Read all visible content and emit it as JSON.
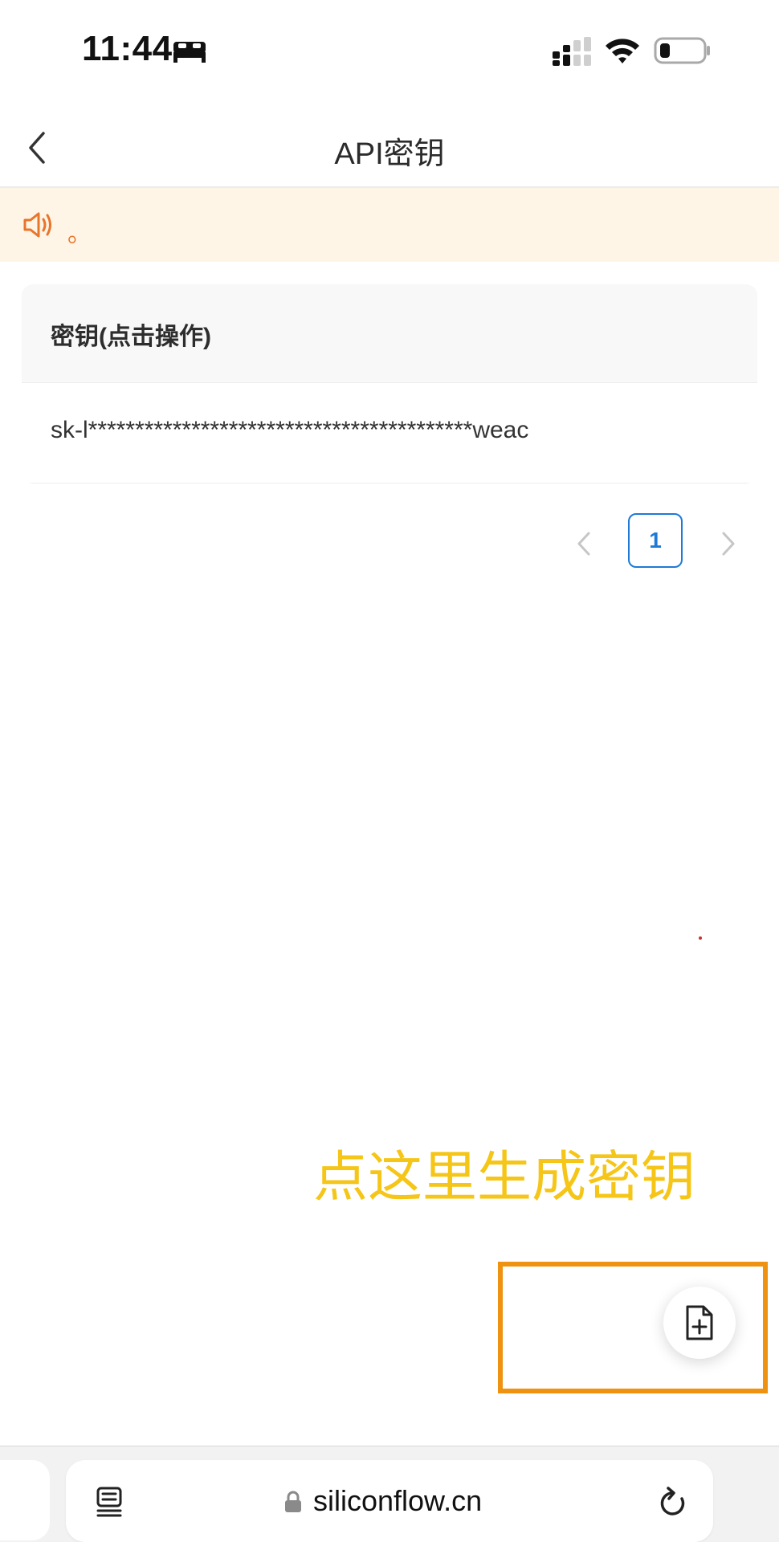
{
  "status_bar": {
    "time": "11:44"
  },
  "nav": {
    "title": "API密钥"
  },
  "notice": {
    "text": "。"
  },
  "table": {
    "header": "密钥(点击操作)",
    "rows": [
      {
        "key": "sk-l*****************************************weac"
      }
    ]
  },
  "pagination": {
    "current_page": "1"
  },
  "annotation": {
    "text": "点这里生成密钥"
  },
  "browser": {
    "url": "siliconflow.cn"
  },
  "icons": {
    "status": [
      "bed-icon",
      "cellular-signal-icon",
      "wifi-icon",
      "battery-icon"
    ],
    "nav": [
      "back-chevron-icon"
    ],
    "notice": [
      "speaker-icon"
    ],
    "fab": [
      "new-document-plus-icon"
    ],
    "browser": [
      "reader-icon",
      "lock-icon",
      "reload-icon"
    ]
  },
  "colors": {
    "notice_background": "#fff5e6",
    "notice_accent": "#e9742b",
    "pagination_active": "#1e7ad6",
    "annotation_text": "#f5c518",
    "annotation_box": "#ee9210"
  }
}
